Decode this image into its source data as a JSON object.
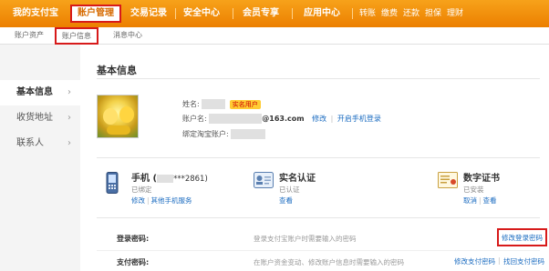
{
  "topnav": {
    "my_alipay": "我的支付宝",
    "account_mgmt": "账户管理",
    "transactions": "交易记录",
    "security": "安全中心",
    "vip": "会员专享",
    "apps": "应用中心",
    "quick_links": [
      "转账",
      "缴费",
      "还款",
      "担保",
      "理财"
    ]
  },
  "subnav": {
    "assets": "账户资产",
    "info": "账户信息",
    "messages": "消息中心"
  },
  "sidebar": {
    "items": [
      {
        "label": "基本信息",
        "active": true
      },
      {
        "label": "收货地址",
        "active": false
      },
      {
        "label": "联系人",
        "active": false
      }
    ],
    "chevron": "›"
  },
  "main": {
    "title": "基本信息",
    "name_label": "姓名:",
    "name_badge": "实名用户",
    "account_label": "账户名:",
    "account_suffix": "@163.com",
    "modify": "修改",
    "enable_phone_login": "开启手机登录",
    "taobao_label": "绑定淘宝账户:",
    "cards": {
      "phone": {
        "title": "手机 (",
        "number": "***2861)",
        "status": "已绑定",
        "modify": "修改",
        "other": "其他手机服务"
      },
      "realname": {
        "title": "实名认证",
        "status": "已认证",
        "view": "查看"
      },
      "cert": {
        "title": "数字证书",
        "status": "已安装",
        "cancel": "取消",
        "view": "查看"
      }
    },
    "login_pwd": {
      "label": "登录密码:",
      "desc": "登录支付宝账户时需要输入的密码",
      "action": "修改登录密码"
    },
    "pay_pwd": {
      "label": "支付密码:",
      "desc": "在账户资金变动、修改账户信息时需要输入的密码",
      "action1": "修改支付密码",
      "action2": "找回支付密码"
    }
  },
  "colors": {
    "brand_orange": "#f08b00",
    "highlight_red": "#d71a1a",
    "link_blue": "#1a6bc0"
  }
}
